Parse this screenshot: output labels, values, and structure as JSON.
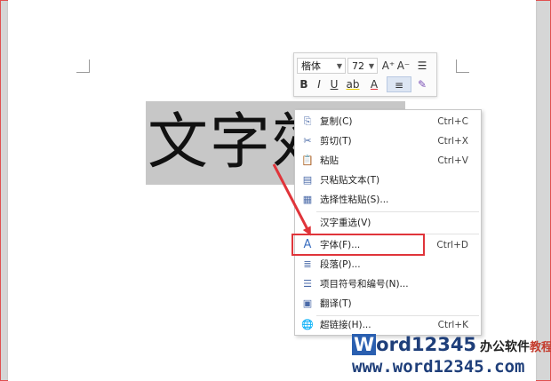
{
  "mini_toolbar": {
    "font_name": "楷体",
    "font_size": "72",
    "grow_font": "A⁺",
    "shrink_font": "A⁻",
    "line_spacing": "☰",
    "bold": "B",
    "italic": "I",
    "underline": "U",
    "highlight": "ab",
    "font_color": "A",
    "align": "≡",
    "format_painter": "✎"
  },
  "document": {
    "selected_text": "文字效"
  },
  "context_menu": {
    "items": [
      {
        "icon": "copy-icon",
        "glyph": "⎘",
        "label": "复制(C)",
        "shortcut": "Ctrl+C"
      },
      {
        "icon": "scissors-icon",
        "glyph": "✂",
        "label": "剪切(T)",
        "shortcut": "Ctrl+X"
      },
      {
        "icon": "paste-icon",
        "glyph": "📋",
        "label": "粘贴",
        "shortcut": "Ctrl+V"
      },
      {
        "icon": "paste-text-icon",
        "glyph": "▤",
        "label": "只粘贴文本(T)",
        "shortcut": ""
      },
      {
        "icon": "paste-special-icon",
        "glyph": "▦",
        "label": "选择性粘贴(S)...",
        "shortcut": ""
      },
      {
        "icon": "",
        "glyph": "",
        "label": "汉字重选(V)",
        "shortcut": ""
      },
      {
        "icon": "font-icon",
        "glyph": "A",
        "label": "字体(F)...",
        "shortcut": "Ctrl+D"
      },
      {
        "icon": "paragraph-icon",
        "glyph": "≣",
        "label": "段落(P)...",
        "shortcut": ""
      },
      {
        "icon": "list-icon",
        "glyph": "☰",
        "label": "项目符号和编号(N)...",
        "shortcut": ""
      },
      {
        "icon": "translate-icon",
        "glyph": "▣",
        "label": "翻译(T)",
        "shortcut": ""
      },
      {
        "icon": "hyperlink-icon",
        "glyph": "🌐",
        "label": "超链接(H)...",
        "shortcut": "Ctrl+K"
      }
    ]
  },
  "watermark": {
    "brand_w": "W",
    "brand_rest": "ord12345",
    "brand_cn1": "办公软件",
    "brand_cn2": "教程",
    "url": "www.word12345.com"
  },
  "colors": {
    "highlight_border": "#e0343a",
    "arrow": "#e0343a",
    "selection": "#c7c7c7",
    "brand_blue": "#2a5fb0"
  }
}
